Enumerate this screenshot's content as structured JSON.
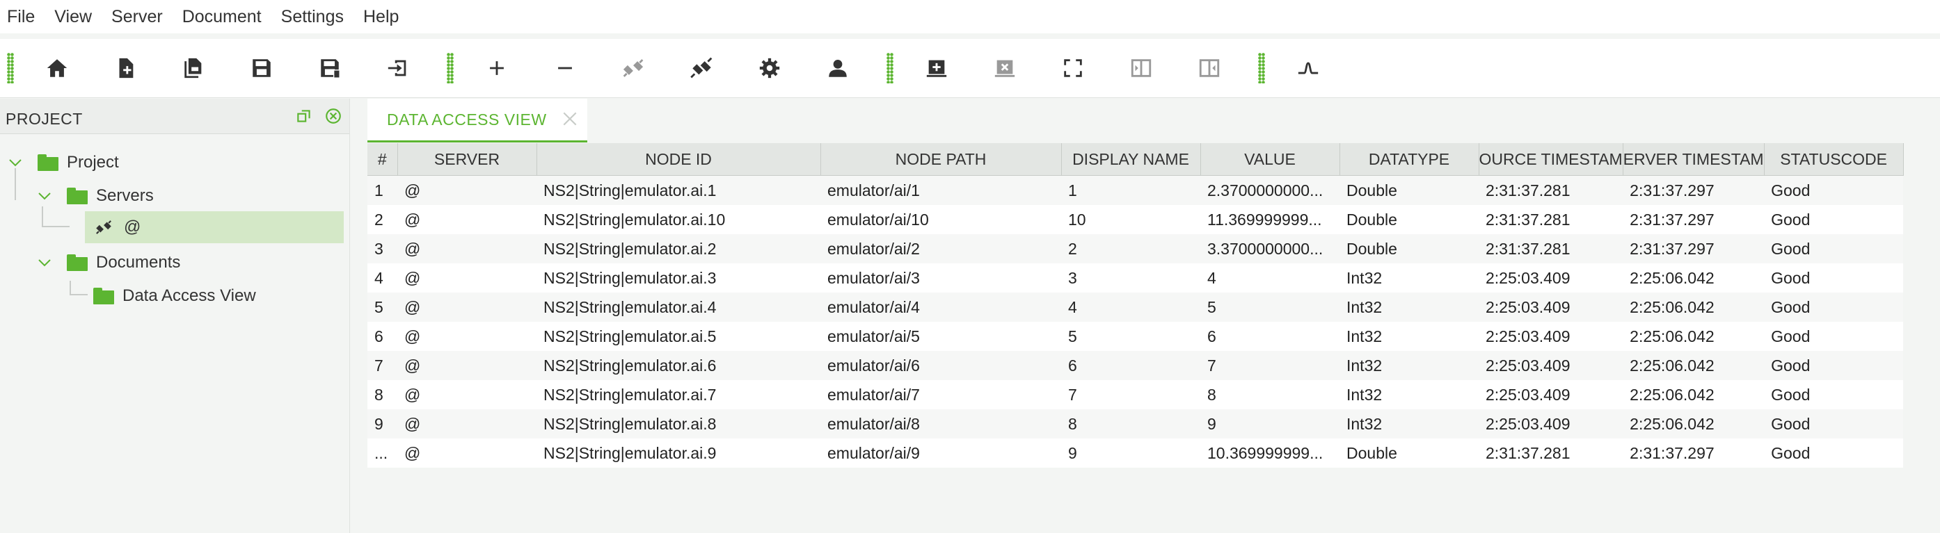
{
  "menu": [
    "File",
    "View",
    "Server",
    "Document",
    "Settings",
    "Help"
  ],
  "toolbar": {
    "icons": [
      "home-icon",
      "new-document-icon",
      "copy-document-icon",
      "save-icon",
      "save-as-icon",
      "export-icon",
      "add-icon",
      "remove-icon",
      "disconnect-icon",
      "connect-icon",
      "settings-icon",
      "user-icon",
      "add-view-icon",
      "close-view-icon",
      "fullscreen-icon",
      "panel-left-icon",
      "panel-right-icon",
      "signal-icon"
    ]
  },
  "left_panel": {
    "title": "PROJECT",
    "tree": {
      "project": "Project",
      "servers": "Servers",
      "server_item": "@",
      "documents": "Documents",
      "document_item": "Data Access View"
    }
  },
  "tab": {
    "label": "DATA ACCESS VIEW"
  },
  "table": {
    "columns": [
      "#",
      "SERVER",
      "NODE ID",
      "NODE PATH",
      "DISPLAY NAME",
      "VALUE",
      "DATATYPE",
      "OURCE TIMESTAM",
      "ERVER TIMESTAM",
      "STATUSCODE"
    ],
    "rows": [
      [
        "1",
        "@",
        "NS2|String|emulator.ai.1",
        "emulator/ai/1",
        "1",
        "2.3700000000...",
        "Double",
        "2:31:37.281",
        "2:31:37.297",
        "Good"
      ],
      [
        "2",
        "@",
        "NS2|String|emulator.ai.10",
        "emulator/ai/10",
        "10",
        "11.369999999...",
        "Double",
        "2:31:37.281",
        "2:31:37.297",
        "Good"
      ],
      [
        "3",
        "@",
        "NS2|String|emulator.ai.2",
        "emulator/ai/2",
        "2",
        "3.3700000000...",
        "Double",
        "2:31:37.281",
        "2:31:37.297",
        "Good"
      ],
      [
        "4",
        "@",
        "NS2|String|emulator.ai.3",
        "emulator/ai/3",
        "3",
        "4",
        "Int32",
        "2:25:03.409",
        "2:25:06.042",
        "Good"
      ],
      [
        "5",
        "@",
        "NS2|String|emulator.ai.4",
        "emulator/ai/4",
        "4",
        "5",
        "Int32",
        "2:25:03.409",
        "2:25:06.042",
        "Good"
      ],
      [
        "6",
        "@",
        "NS2|String|emulator.ai.5",
        "emulator/ai/5",
        "5",
        "6",
        "Int32",
        "2:25:03.409",
        "2:25:06.042",
        "Good"
      ],
      [
        "7",
        "@",
        "NS2|String|emulator.ai.6",
        "emulator/ai/6",
        "6",
        "7",
        "Int32",
        "2:25:03.409",
        "2:25:06.042",
        "Good"
      ],
      [
        "8",
        "@",
        "NS2|String|emulator.ai.7",
        "emulator/ai/7",
        "7",
        "8",
        "Int32",
        "2:25:03.409",
        "2:25:06.042",
        "Good"
      ],
      [
        "9",
        "@",
        "NS2|String|emulator.ai.8",
        "emulator/ai/8",
        "8",
        "9",
        "Int32",
        "2:25:03.409",
        "2:25:06.042",
        "Good"
      ],
      [
        "...",
        "@",
        "NS2|String|emulator.ai.9",
        "emulator/ai/9",
        "9",
        "10.369999999...",
        "Double",
        "2:31:37.281",
        "2:31:37.297",
        "Good"
      ]
    ]
  },
  "colors": {
    "accent": "#5cb531",
    "selected": "#d4e8c7",
    "icon": "#333333"
  }
}
